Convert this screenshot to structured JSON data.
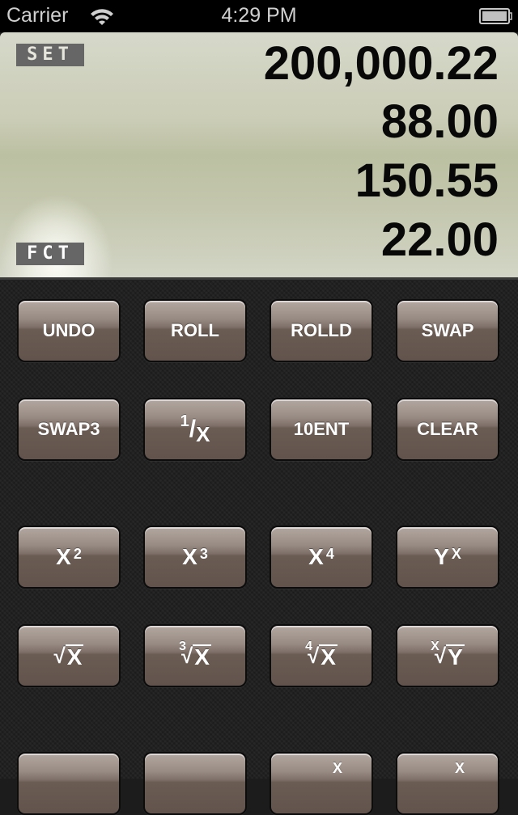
{
  "status_bar": {
    "carrier": "Carrier",
    "time": "4:29 PM",
    "icons": [
      "wifi-icon",
      "battery-icon"
    ]
  },
  "display": {
    "set_indicator": "SET",
    "fct_indicator": "FCT",
    "stack": [
      "200,000.22",
      "88.00",
      "150.55",
      "22.00"
    ]
  },
  "keys": {
    "row0": [
      "UNDO",
      "ROLL",
      "ROLLD",
      "SWAP"
    ],
    "row1": {
      "swap3": "SWAP3",
      "reciprocal_num": "1",
      "reciprocal_slash": "/",
      "reciprocal_den": "X",
      "tenent": "10ENT",
      "clear": "CLEAR"
    },
    "row2": {
      "base": "X",
      "x2_exp": "2",
      "x3_exp": "3",
      "x4_exp": "4",
      "y_base": "Y",
      "yx_exp": "X"
    },
    "row3": {
      "radical": "√",
      "radicand_x": "X",
      "radicand_y": "Y",
      "cbrt_index": "3",
      "root4_index": "4",
      "xroot_index": "X"
    },
    "row4": {
      "key3_sup": "X",
      "key4_sup": "X"
    }
  },
  "colors": {
    "display_bg": "#c8cab2",
    "key_top": "#b3a8a1",
    "key_bottom": "#62544c",
    "keypad_bg": "#1e1e1e",
    "indicator_bg": "#666666"
  }
}
